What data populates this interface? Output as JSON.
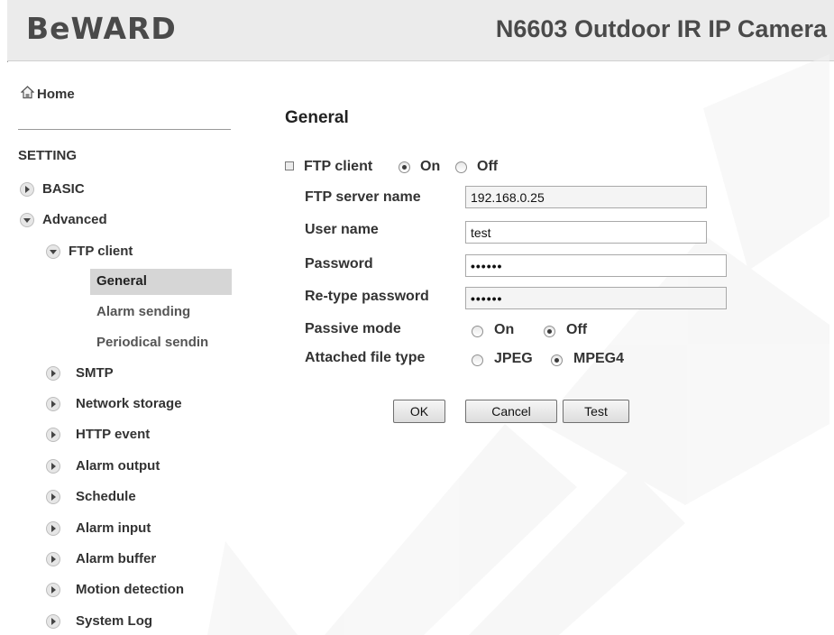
{
  "header": {
    "logo": "BeWARD",
    "product": "N6603 Outdoor IR IP Camera"
  },
  "sidebar": {
    "home": "Home",
    "section": "SETTING",
    "basic": "BASIC",
    "advanced": "Advanced",
    "ftp_client": "FTP client",
    "ftp_sub": [
      "General",
      "Alarm sending",
      "Periodical sendin"
    ],
    "items": [
      "SMTP",
      "Network storage",
      "HTTP event",
      "Alarm output",
      "Schedule",
      "Alarm input",
      "Alarm buffer",
      "Motion detection",
      "System Log"
    ]
  },
  "main": {
    "title": "General",
    "ftp_client_label": "FTP client",
    "on": "On",
    "off": "Off",
    "server_label": "FTP server name",
    "server_value": "192.168.0.25",
    "user_label": "User name",
    "user_value": "test",
    "password_label": "Password",
    "password_value": "••••••",
    "retype_label": "Re-type password",
    "retype_value": "••••••",
    "passive_label": "Passive mode",
    "passive_on": "On",
    "passive_off": "Off",
    "filetype_label": "Attached file type",
    "jpeg": "JPEG",
    "mpeg4": "MPEG4"
  },
  "buttons": {
    "ok": "OK",
    "cancel": "Cancel",
    "test": "Test"
  },
  "colors": {
    "header_bg": "#ebebeb",
    "selected_bg": "#d6d6d6",
    "text": "#333333"
  }
}
